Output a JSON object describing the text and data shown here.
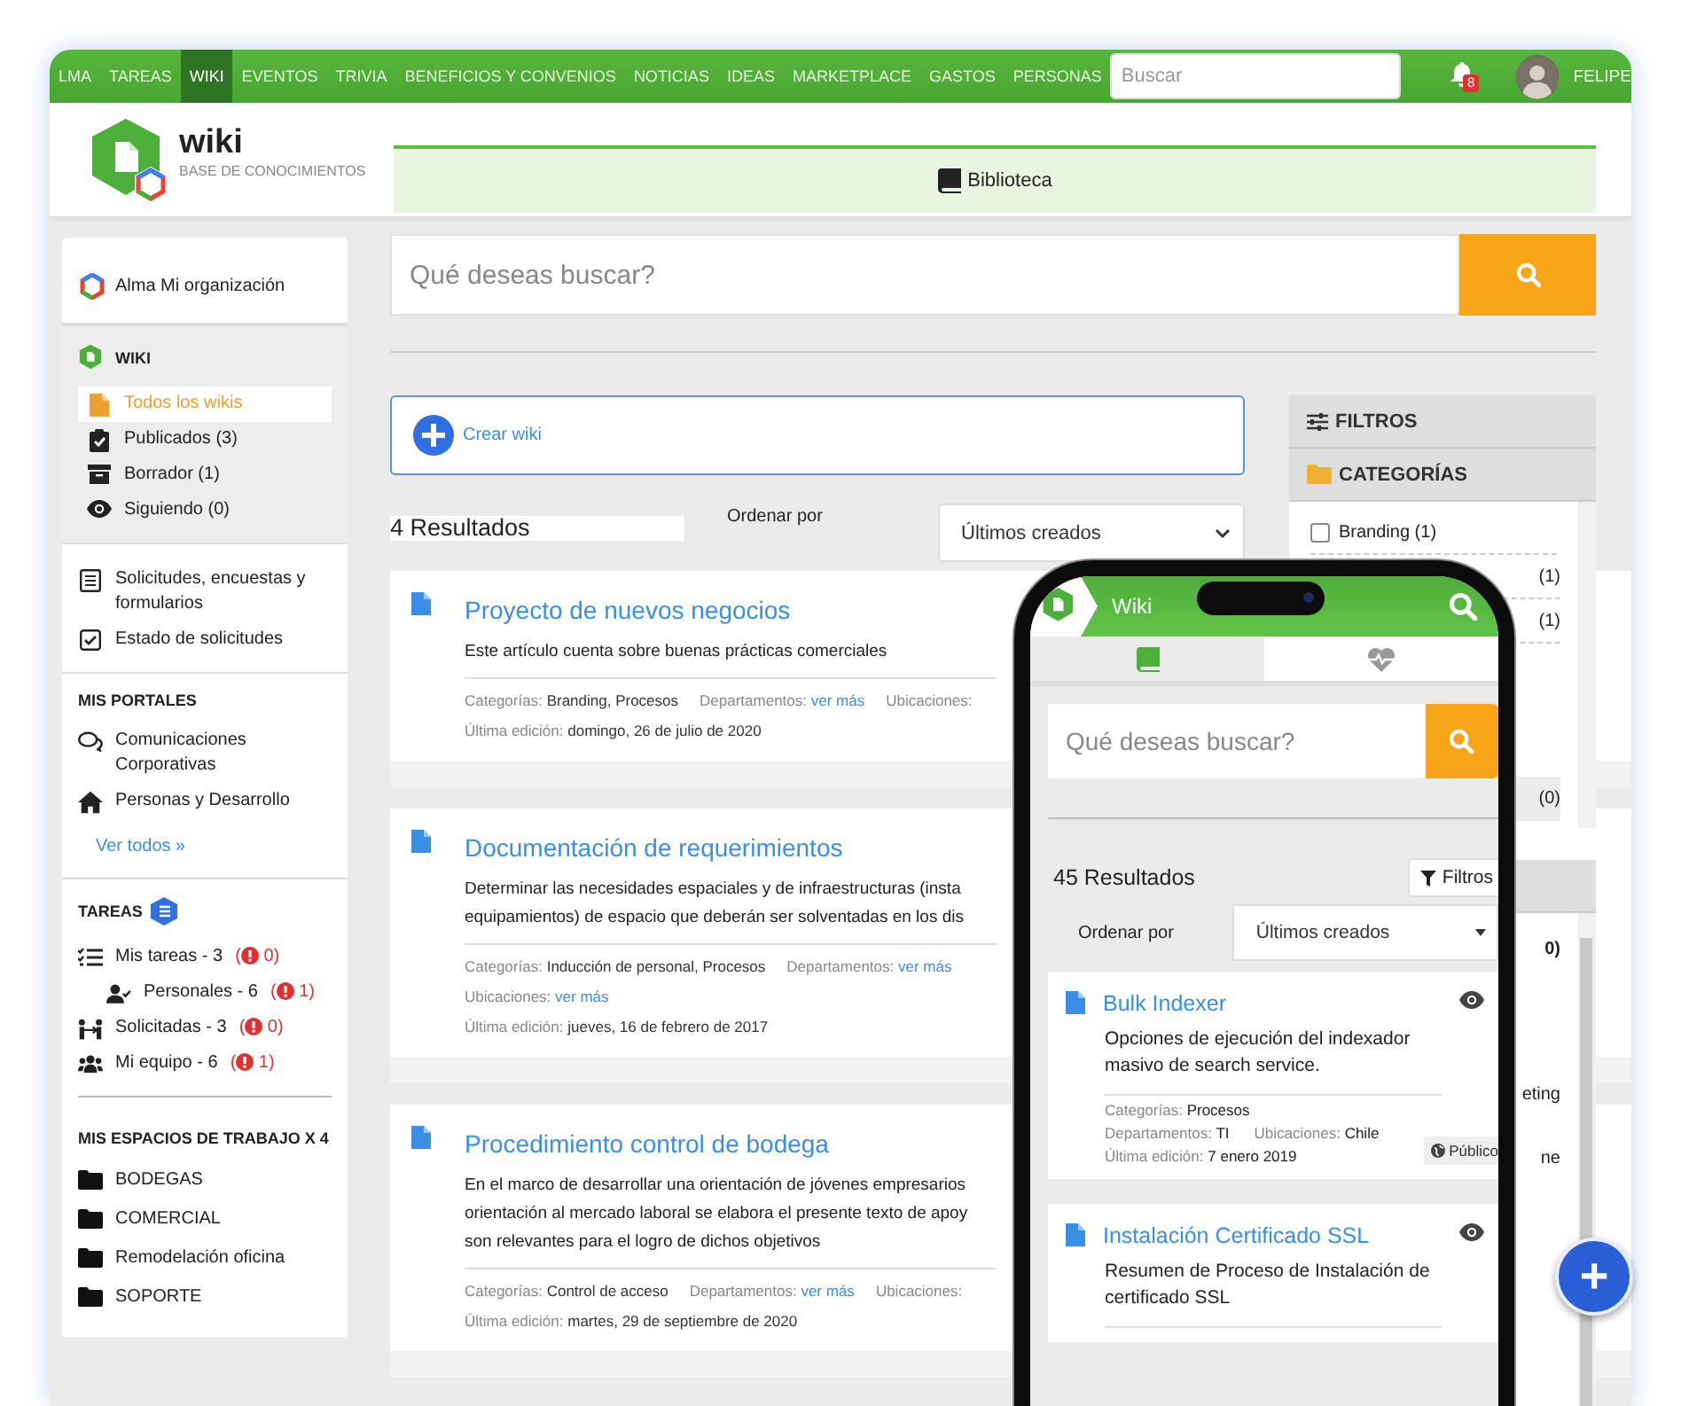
{
  "nav": {
    "items": [
      {
        "label": "LMA",
        "selected": false
      },
      {
        "label": "TAREAS",
        "selected": false
      },
      {
        "label": "WIKI",
        "selected": true
      },
      {
        "label": "EVENTOS",
        "selected": false
      },
      {
        "label": "TRIVIA",
        "selected": false
      },
      {
        "label": "BENEFICIOS Y CONVENIOS",
        "selected": false
      },
      {
        "label": "NOTICIAS",
        "selected": false
      },
      {
        "label": "IDEAS",
        "selected": false
      },
      {
        "label": "MARKETPLACE",
        "selected": false
      },
      {
        "label": "GASTOS",
        "selected": false
      },
      {
        "label": "PERSONAS",
        "selected": false
      }
    ],
    "search": {
      "placeholder": "Buscar"
    },
    "notifications": "8",
    "user": "FELIPE"
  },
  "header": {
    "title": "wiki",
    "subtitle": "BASE DE CONOCIMIENTOS",
    "tabs": [
      {
        "label": "Biblioteca",
        "selected": true
      }
    ]
  },
  "sidebar": {
    "organization": "Alma Mi organización",
    "wiki": {
      "title": "WIKI",
      "items": [
        {
          "label": "Todos los wikis",
          "selected": true
        },
        {
          "label": "Publicados (3)",
          "selected": false
        },
        {
          "label": "Borrador (1)",
          "selected": false
        },
        {
          "label": "Siguiendo (0)",
          "selected": false
        }
      ]
    },
    "forms": [
      {
        "label": "Solicitudes, encuestas y formularios"
      },
      {
        "label": "Estado de solicitudes"
      }
    ],
    "portals": {
      "title": "MIS PORTALES",
      "items": [
        {
          "label": "Comunicaciones Corporativas"
        },
        {
          "label": "Personas y Desarrollo"
        }
      ],
      "link": "Ver todos »"
    },
    "tasks": {
      "title": "TAREAS",
      "items": [
        {
          "label": "Mis tareas - 3",
          "alert": {
            "open": "(",
            "count": "0)"
          },
          "children": [
            {
              "label": "Personales - 6",
              "alert": {
                "open": "(",
                "count": "1)"
              }
            }
          ]
        },
        {
          "label": "Solicitadas - 3",
          "alert": {
            "open": "(",
            "count": "0)"
          }
        },
        {
          "label": "Mi equipo - 6",
          "alert": {
            "open": "(",
            "count": "1)"
          }
        }
      ]
    },
    "workspaces": {
      "title": "MIS ESPACIOS DE TRABAJO X 4",
      "items": [
        "BODEGAS",
        "COMERCIAL",
        "Remodelación oficina",
        "SOPORTE"
      ]
    }
  },
  "main": {
    "search": {
      "placeholder": "Qué deseas buscar?"
    },
    "create": "Crear wiki",
    "results": "4 Resultados",
    "sort_label": "Ordenar por",
    "sort_value": "Últimos creados",
    "articles": [
      {
        "title": "Proyecto de nuevos negocios",
        "lines": [
          "Este artículo cuenta sobre buenas prácticas comerciales"
        ],
        "meta": [
          [
            {
              "label": "Categorías:",
              "value": "Branding, Procesos",
              "kind": "text"
            },
            {
              "label": "Departamentos:",
              "value": "ver más",
              "kind": "link"
            },
            {
              "label": "Ubicaciones:"
            }
          ],
          [
            {
              "label": "Última edición:",
              "value": "domingo, 26 de julio de 2020",
              "kind": "text"
            }
          ]
        ]
      },
      {
        "title": "Documentación de requerimientos",
        "lines": [
          "Determinar las necesidades espaciales y de infraestructuras (insta",
          "equipamientos) de espacio que deberán ser solventadas en los dis"
        ],
        "meta": [
          [
            {
              "label": "Categorías:",
              "value": "Inducción de personal, Procesos",
              "kind": "text"
            },
            {
              "label": "Departamentos:",
              "value": "ver más",
              "kind": "link"
            }
          ],
          [
            {
              "label": "Ubicaciones:",
              "value": "ver más",
              "kind": "link"
            }
          ],
          [
            {
              "label": "Última edición:",
              "value": "jueves, 16 de febrero de 2017",
              "kind": "text"
            }
          ]
        ]
      },
      {
        "title": "Procedimiento control de bodega",
        "lines": [
          "En el marco de desarrollar una orientación de jóvenes empresarios",
          "orientación al mercado laboral se elabora el presente texto de apoy",
          "son relevantes para el logro de dichos objetivos"
        ],
        "meta": [
          [
            {
              "label": "Categorías:",
              "value": "Control de acceso",
              "kind": "text"
            },
            {
              "label": "Departamentos:",
              "value": "ver más",
              "kind": "link"
            },
            {
              "label": "Ubicaciones:"
            }
          ],
          [
            {
              "label": "Última edición:",
              "value": "martes, 29 de septiembre de 2020",
              "kind": "text"
            }
          ]
        ]
      }
    ]
  },
  "filters": {
    "title": "FILTROS",
    "sections": [
      {
        "title": "CATEGORÍAS",
        "items": [
          {
            "kind": "checkbox",
            "label": "Branding (1)",
            "checked": false
          },
          {
            "kind": "fragment",
            "label": "(1)"
          },
          {
            "kind": "fragment",
            "label": "(1)"
          },
          {
            "kind": "fragment",
            "label": "(0)"
          }
        ]
      },
      {
        "items": [
          {
            "kind": "fragment",
            "label": "0)"
          },
          {
            "kind": "fragment",
            "label": "eting"
          },
          {
            "kind": "fragment",
            "label": "ne"
          }
        ]
      }
    ]
  },
  "mobile": {
    "title": "Wiki",
    "tabs": [
      {
        "selected": true
      },
      {
        "selected": false
      }
    ],
    "search": {
      "placeholder": "Qué deseas buscar?"
    },
    "results": "45 Resultados",
    "filter_button": "Filtros",
    "sort_label": "Ordenar por",
    "sort_value": "Últimos creados",
    "articles": [
      {
        "title": "Bulk Indexer",
        "description": "Opciones de ejecución del indexador masivo de search service.",
        "meta": [
          [
            {
              "label": "Categorías:",
              "value": "Procesos"
            }
          ],
          [
            {
              "label": "Departamentos:",
              "value": "TI"
            },
            {
              "label": "Ubicaciones:",
              "value": "Chile"
            }
          ],
          [
            {
              "label": "Última edición:",
              "value": "7 enero 2019"
            }
          ]
        ],
        "visibility": "Público"
      },
      {
        "title": "Instalación Certificado SSL",
        "description": "Resumen de Proceso de Instalación de certificado SSL"
      }
    ]
  },
  "fab": "+"
}
